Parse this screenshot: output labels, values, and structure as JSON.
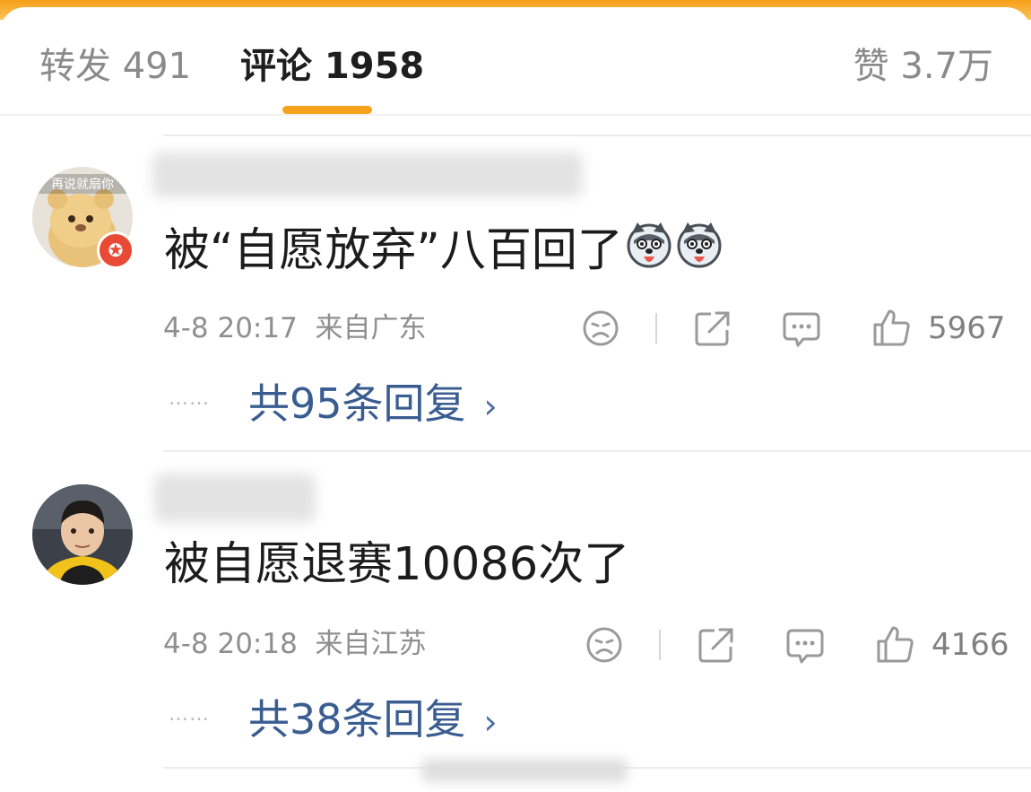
{
  "tabs": {
    "repost": "转发 491",
    "comments": "评论 1958",
    "likes": "赞 3.7万"
  },
  "colors": {
    "accent": "#f7a21b",
    "reply_link": "#3a5d91",
    "verified_badge": "#e84a35"
  },
  "comments": [
    {
      "avatar_caption": "再说就扇你",
      "text": "被“自愿放弃”八百回了",
      "emojis": [
        "husky-emoji",
        "husky-emoji"
      ],
      "time": "4-8 20:17",
      "location": "来自广东",
      "likes": "5967",
      "replies": "共95条回复",
      "replies_dots": "……",
      "replies_chevron": "›"
    },
    {
      "text": "被自愿退赛10086次了",
      "time": "4-8 20:18",
      "location": "来自江苏",
      "likes": "4166",
      "replies": "共38条回复",
      "replies_dots": "……",
      "replies_chevron": "›"
    }
  ],
  "icons": [
    "sad-face-icon",
    "share-icon",
    "comment-icon",
    "thumbs-up-icon",
    "chevron-right-icon"
  ]
}
